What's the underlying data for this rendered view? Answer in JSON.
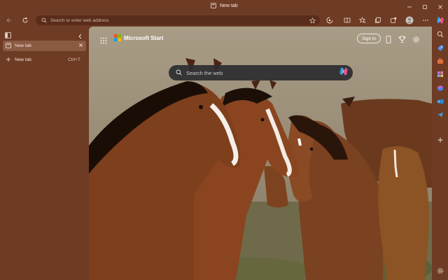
{
  "titlebar": {
    "tab_title": "New tab"
  },
  "toolbar": {
    "address_placeholder": "Search or enter web address"
  },
  "vertical_tabs": {
    "active_tab_label": "New tab",
    "new_tab_label": "New tab",
    "new_tab_shortcut": "Ctrl+T"
  },
  "ms_start": {
    "brand": "Microsoft Start",
    "sign_in_label": "Sign in",
    "search_placeholder": "Search the web"
  },
  "colors": {
    "theme_frame": "#6e3b24",
    "address_bar": "#5a2d1a",
    "active_tab": "#8b5a43",
    "ms_red": "#f25022",
    "ms_green": "#7fba00",
    "ms_blue": "#00a4ef",
    "ms_yellow": "#ffb900"
  },
  "icons": [
    "new-tab-page-icon",
    "back-icon",
    "refresh-icon",
    "favorite-star-icon",
    "browser-essentials-icon",
    "split-screen-icon",
    "favorites-icon",
    "collections-icon",
    "extensions-icon",
    "profile-avatar-icon",
    "more-icon",
    "copilot-icon",
    "search-icon",
    "tag-icon",
    "briefcase-icon",
    "games-icon",
    "m365-icon",
    "outlook-icon",
    "send-icon",
    "add-icon",
    "settings-icon",
    "app-launcher-icon",
    "mobile-icon",
    "trophy-icon"
  ]
}
